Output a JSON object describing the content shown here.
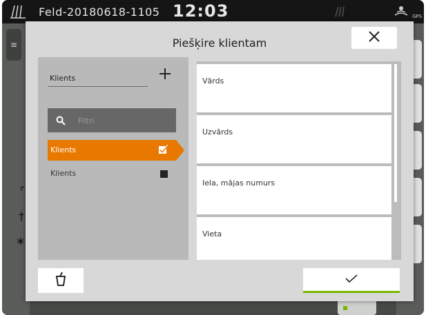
{
  "statusbar": {
    "field_name": "Feld-20180618-1105",
    "clock": "12:03",
    "gps_label": "GPS",
    "field_icon": "field-icon",
    "signal_icon": "signal-icon",
    "gps_icon": "satellite-icon"
  },
  "dialog": {
    "title": "Piešķire klientam",
    "close_icon": "close-icon"
  },
  "left_panel": {
    "header_label": "Klients",
    "add_icon": "plus-icon",
    "filter": {
      "placeholder": "Filtri",
      "value": "",
      "icon": "search-icon"
    },
    "items": [
      {
        "label": "Klients",
        "selected": true,
        "status_icon": "check-box-icon"
      },
      {
        "label": "Klients",
        "selected": false,
        "status_icon": "square-icon"
      }
    ]
  },
  "right_panel": {
    "fields": [
      {
        "label": "Vārds",
        "value": ""
      },
      {
        "label": "Uzvārds",
        "value": ""
      },
      {
        "label": "Iela, mājas numurs",
        "value": ""
      },
      {
        "label": "Vieta",
        "value": ""
      }
    ]
  },
  "footer": {
    "delete_icon": "trash-icon",
    "confirm_icon": "checkmark-icon"
  },
  "colors": {
    "accent_orange": "#e87800",
    "confirm_green": "#7ab800",
    "dialog_bg": "#d8d8d8",
    "panel_gray": "#b9b9b9"
  }
}
